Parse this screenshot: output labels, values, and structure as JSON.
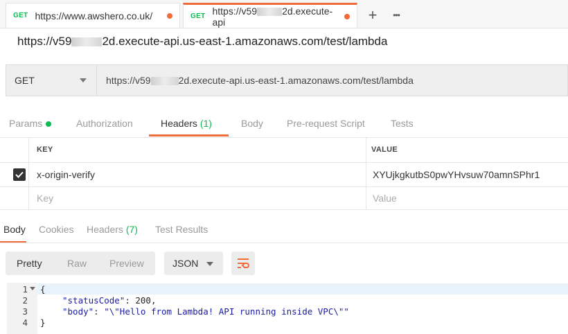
{
  "tabs": [
    {
      "method": "GET",
      "label": "https://www.awshero.co.uk/",
      "active": false
    },
    {
      "method": "GET",
      "label_prefix": "https://v59",
      "label_suffix": "2d.execute-api",
      "active": true
    }
  ],
  "tab_actions": {
    "add": "+",
    "more": "•••"
  },
  "request": {
    "title_prefix": "https://v59",
    "title_suffix": "2d.execute-api.us-east-1.amazonaws.com/test/lambda",
    "method": "GET",
    "url_prefix": "https://v59",
    "url_suffix": "2d.execute-api.us-east-1.amazonaws.com/test/lambda"
  },
  "request_tabs": {
    "params": "Params",
    "authorization": "Authorization",
    "headers": "Headers",
    "headers_count": "(1)",
    "body": "Body",
    "prerequest": "Pre-request Script",
    "tests": "Tests"
  },
  "headers_table": {
    "col_key": "KEY",
    "col_value": "VALUE",
    "rows": [
      {
        "key": "x-origin-verify",
        "value": "XYUjkgkutbS0pwYHvsuw70amnSPhr1",
        "checked": true
      }
    ],
    "placeholder_key": "Key",
    "placeholder_value": "Value"
  },
  "response_tabs": {
    "body": "Body",
    "cookies": "Cookies",
    "headers": "Headers",
    "headers_count": "(7)",
    "test_results": "Test Results"
  },
  "format": {
    "pretty": "Pretty",
    "raw": "Raw",
    "preview": "Preview",
    "type": "JSON"
  },
  "code": {
    "line_numbers": [
      "1",
      "2",
      "3",
      "4"
    ],
    "line1": "{",
    "line2_key": "\"statusCode\"",
    "line2_rest": ": 200,",
    "line3_key": "\"body\"",
    "line3_sep": ": ",
    "line3_val": "\"\\\"Hello from Lambda! API running inside VPC\\\"\"",
    "line4": "}"
  },
  "colors": {
    "accent": "#f26b3a",
    "method_green": "#0cbb52"
  }
}
